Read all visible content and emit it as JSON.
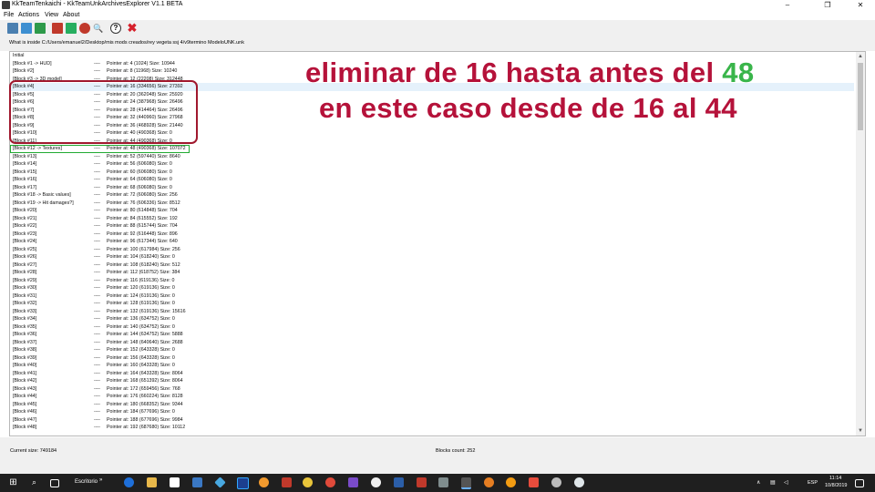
{
  "window": {
    "title": "KkTeamTenkaichi - KkTeamUnkArchivesExplorer V1.1 BETA",
    "controls": [
      "–",
      "❐",
      "✕"
    ]
  },
  "menu": [
    "File",
    "Actions",
    "View",
    "About"
  ],
  "toolbar": {
    "icons": [
      "open-icon",
      "save-icon",
      "save-as-icon",
      "import-icon",
      "export-icon",
      "block-icon",
      "search-icon",
      "help-icon",
      "close-icon"
    ]
  },
  "path": "What is inside C:/Users/emanuel2/Desktop/mis mods creados/rey vegeta ssj 4/v9termino ModeloUNK.unk",
  "list": {
    "first_row": "Initial",
    "separator": "----",
    "rows": [
      {
        "name": "[Block #1 -> HUD]",
        "info": "Pointer at: 4 (1024) Size: 10944"
      },
      {
        "name": "[Block #2]",
        "info": "Pointer at: 8 (11968) Size: 10240"
      },
      {
        "name": "[Block #3 -> 3D model]",
        "info": "Pointer at: 12 (22208) Size: 312448"
      },
      {
        "name": "[Block #4]",
        "info": "Pointer at: 16 (334656) Size: 27392"
      },
      {
        "name": "[Block #5]",
        "info": "Pointer at: 20 (362048) Size: 25920"
      },
      {
        "name": "[Block #6]",
        "info": "Pointer at: 24 (387968) Size: 26496"
      },
      {
        "name": "[Block #7]",
        "info": "Pointer at: 28 (414464) Size: 26496"
      },
      {
        "name": "[Block #8]",
        "info": "Pointer at: 32 (440960) Size: 27968"
      },
      {
        "name": "[Block #9]",
        "info": "Pointer at: 36 (468928) Size: 21440"
      },
      {
        "name": "[Block #10]",
        "info": "Pointer at: 40 (490368) Size: 0"
      },
      {
        "name": "[Block #11]",
        "info": "Pointer at: 44 (490368) Size: 0"
      },
      {
        "name": "[Block #12 -> Textures]",
        "info": "Pointer at: 48 (490368) Size: 107072"
      },
      {
        "name": "[Block #13]",
        "info": "Pointer at: 52 (597440) Size: 8640"
      },
      {
        "name": "[Block #14]",
        "info": "Pointer at: 56 (606080) Size: 0"
      },
      {
        "name": "[Block #15]",
        "info": "Pointer at: 60 (606080) Size: 0"
      },
      {
        "name": "[Block #16]",
        "info": "Pointer at: 64 (606080) Size: 0"
      },
      {
        "name": "[Block #17]",
        "info": "Pointer at: 68 (606080) Size: 0"
      },
      {
        "name": "[Block #18 -> Basic values]",
        "info": "Pointer at: 72 (606080) Size: 256"
      },
      {
        "name": "[Block #19 -> Hit damages?]",
        "info": "Pointer at: 76 (606336) Size: 8512"
      },
      {
        "name": "[Block #20]",
        "info": "Pointer at: 80 (614848) Size: 704"
      },
      {
        "name": "[Block #21]",
        "info": "Pointer at: 84 (615552) Size: 192"
      },
      {
        "name": "[Block #22]",
        "info": "Pointer at: 88 (615744) Size: 704"
      },
      {
        "name": "[Block #23]",
        "info": "Pointer at: 92 (616448) Size: 896"
      },
      {
        "name": "[Block #24]",
        "info": "Pointer at: 96 (617344) Size: 640"
      },
      {
        "name": "[Block #25]",
        "info": "Pointer at: 100 (617984) Size: 256"
      },
      {
        "name": "[Block #26]",
        "info": "Pointer at: 104 (618240) Size: 0"
      },
      {
        "name": "[Block #27]",
        "info": "Pointer at: 108 (618240) Size: 512"
      },
      {
        "name": "[Block #28]",
        "info": "Pointer at: 112 (618752) Size: 384"
      },
      {
        "name": "[Block #29]",
        "info": "Pointer at: 116 (619136) Size: 0"
      },
      {
        "name": "[Block #30]",
        "info": "Pointer at: 120 (619136) Size: 0"
      },
      {
        "name": "[Block #31]",
        "info": "Pointer at: 124 (619136) Size: 0"
      },
      {
        "name": "[Block #32]",
        "info": "Pointer at: 128 (619136) Size: 0"
      },
      {
        "name": "[Block #33]",
        "info": "Pointer at: 132 (619136) Size: 15616"
      },
      {
        "name": "[Block #34]",
        "info": "Pointer at: 136 (634752) Size: 0"
      },
      {
        "name": "[Block #35]",
        "info": "Pointer at: 140 (634752) Size: 0"
      },
      {
        "name": "[Block #36]",
        "info": "Pointer at: 144 (634752) Size: 5888"
      },
      {
        "name": "[Block #37]",
        "info": "Pointer at: 148 (640640) Size: 2688"
      },
      {
        "name": "[Block #38]",
        "info": "Pointer at: 152 (643328) Size: 0"
      },
      {
        "name": "[Block #39]",
        "info": "Pointer at: 156 (643328) Size: 0"
      },
      {
        "name": "[Block #40]",
        "info": "Pointer at: 160 (643328) Size: 0"
      },
      {
        "name": "[Block #41]",
        "info": "Pointer at: 164 (643328) Size: 8064"
      },
      {
        "name": "[Block #42]",
        "info": "Pointer at: 168 (651392) Size: 8064"
      },
      {
        "name": "[Block #43]",
        "info": "Pointer at: 172 (659456) Size: 768"
      },
      {
        "name": "[Block #44]",
        "info": "Pointer at: 176 (660224) Size: 8128"
      },
      {
        "name": "[Block #45]",
        "info": "Pointer at: 180 (668352) Size: 9344"
      },
      {
        "name": "[Block #46]",
        "info": "Pointer at: 184 (677696) Size: 0"
      },
      {
        "name": "[Block #47]",
        "info": "Pointer at: 188 (677696) Size: 9984"
      },
      {
        "name": "[Block #48]",
        "info": "Pointer at: 192 (687680) Size: 10112"
      }
    ],
    "selected_index": 3
  },
  "annotation": {
    "line1_text": "eliminar de 16 hasta antes del ",
    "line1_highlight": "48",
    "line2_text": "en este caso desde de 16 al 44",
    "text_color": "#b5123a",
    "highlight_color": "#39b54a",
    "box_color": "#a0182e",
    "green_box_color": "#22aa33"
  },
  "status": {
    "current_size": "Current size:  749184",
    "blocks_count": "Blocks count:     252"
  },
  "taskbar": {
    "search_label": "Escritorio",
    "chevron": "»",
    "tray_lang": "ESP",
    "time": "11:14",
    "date": "10/8/2019"
  }
}
